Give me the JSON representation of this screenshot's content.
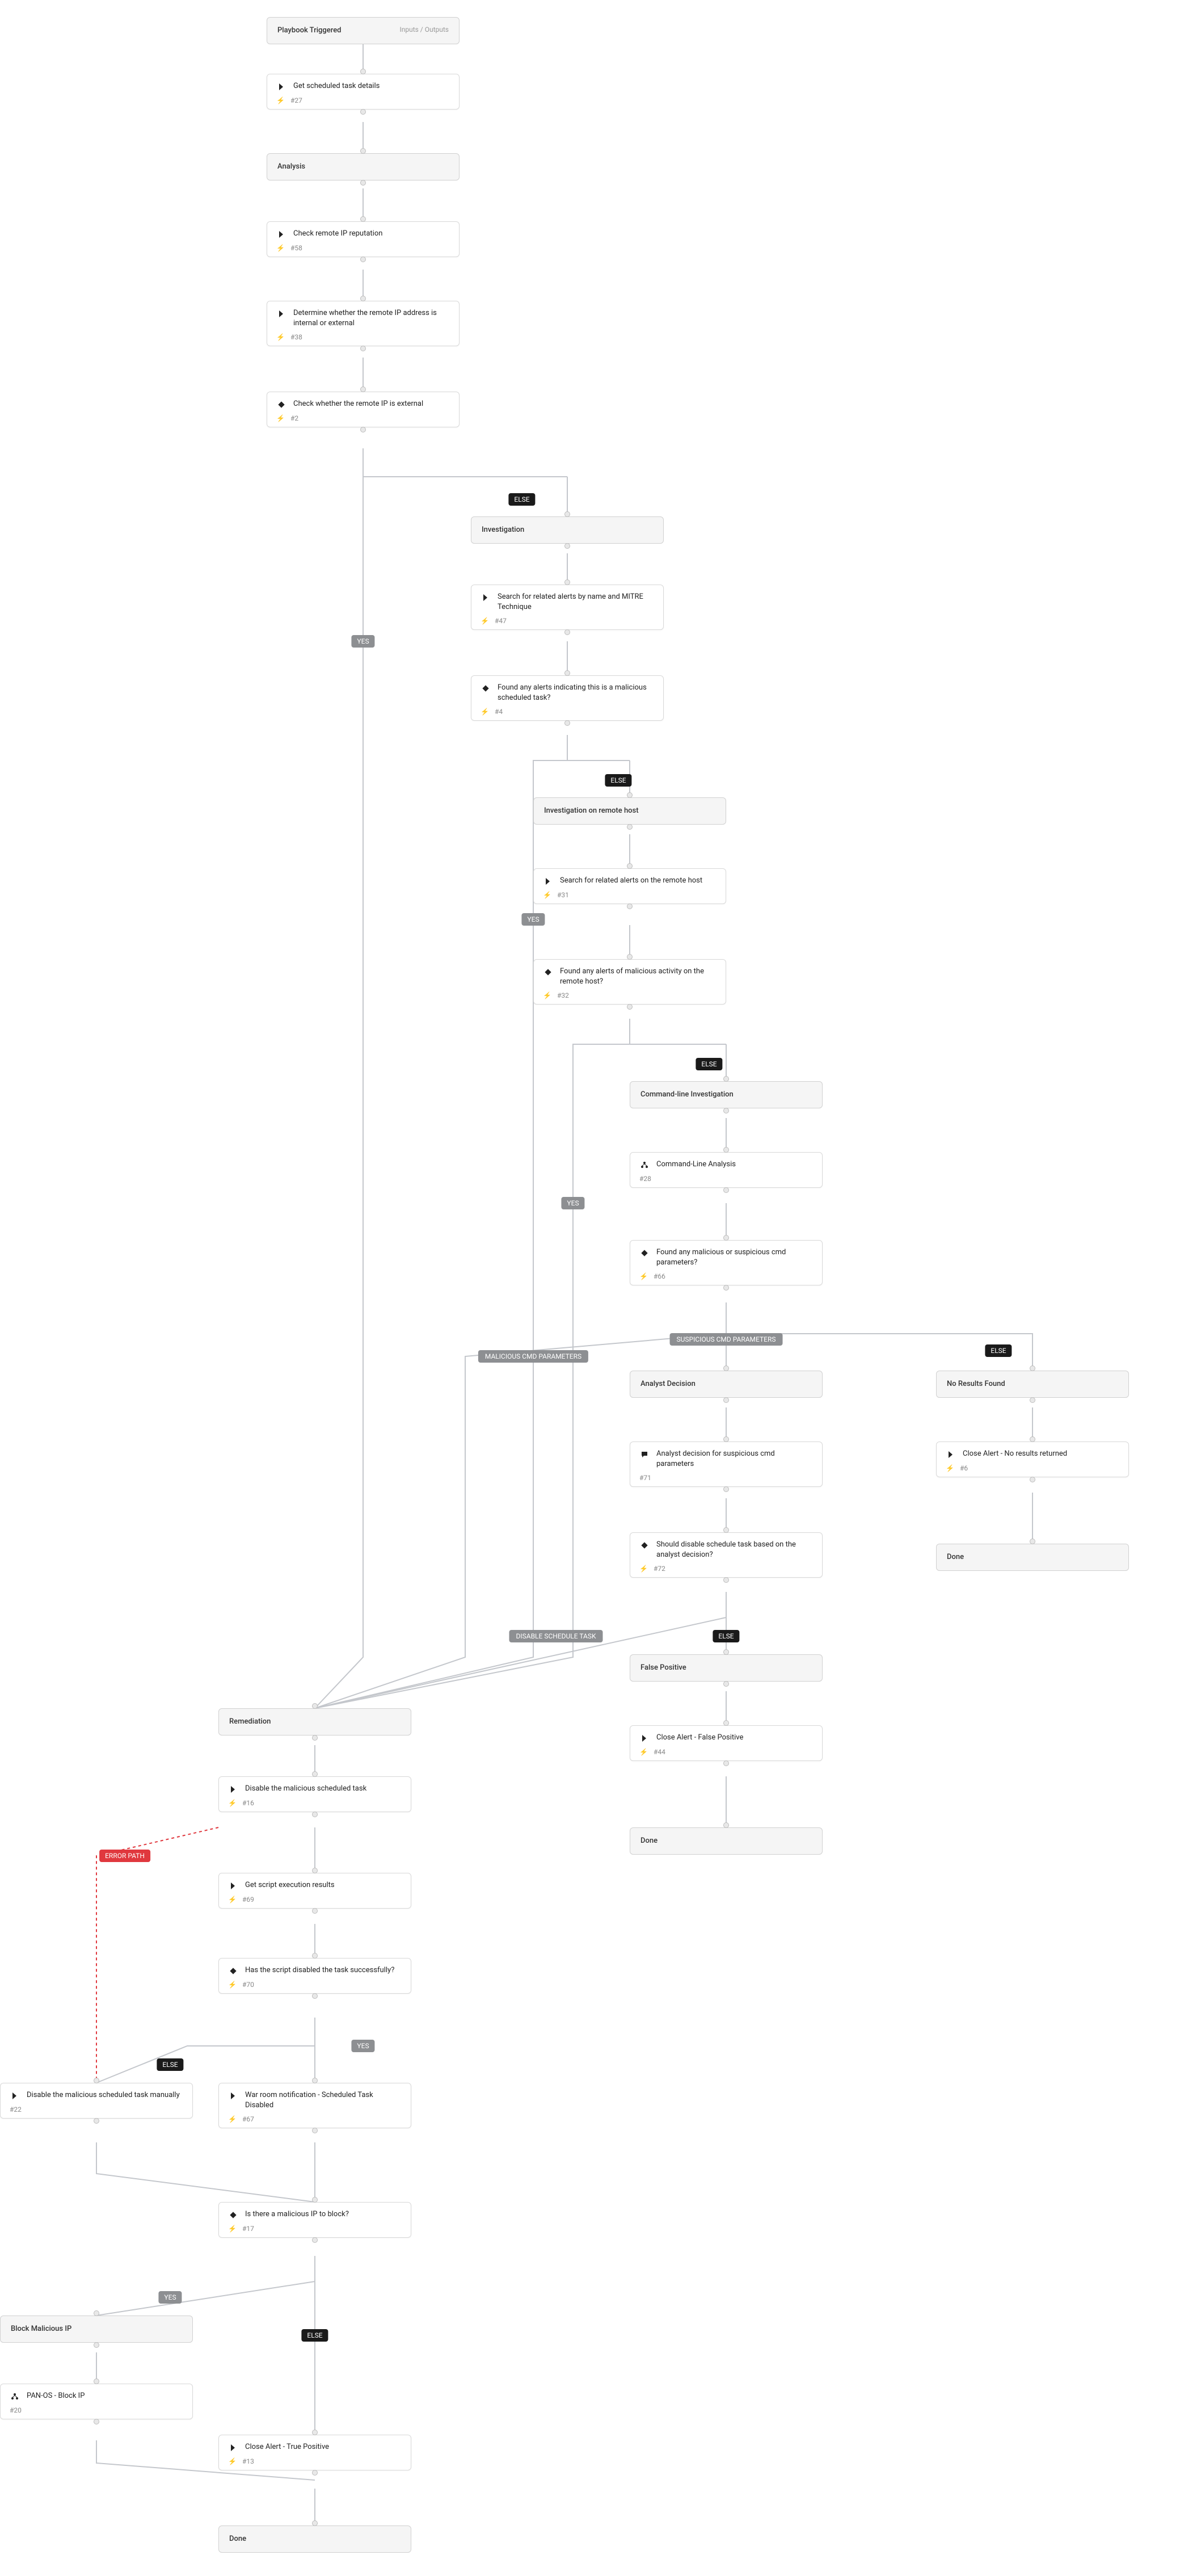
{
  "header": {
    "title": "Playbook Triggered",
    "io_label": "Inputs / Outputs"
  },
  "labels": {
    "yes": "YES",
    "else": "ELSE",
    "suspicious_cmd_parameters": "SUSPICIOUS CMD PARAMETERS",
    "malicious_cmd_parameters": "MALICIOUS CMD PARAMETERS",
    "disable_schedule_task": "DISABLE SCHEDULE TASK",
    "error_path": "ERROR PATH"
  },
  "sections": {
    "analysis": "Analysis",
    "investigation": "Investigation",
    "investigation_remote": "Investigation on remote host",
    "cmd_investigation": "Command-line Investigation",
    "analyst_decision": "Analyst Decision",
    "no_results": "No Results Found",
    "remediation": "Remediation",
    "false_positive": "False Positive",
    "block_ip": "Block Malicious IP",
    "done": "Done"
  },
  "tasks": {
    "t27": {
      "title": "Get scheduled task details",
      "id": "#27"
    },
    "t58": {
      "title": "Check remote IP reputation",
      "id": "#58"
    },
    "t38": {
      "title": "Determine whether the remote IP address is internal or external",
      "id": "#38"
    },
    "t2": {
      "title": "Check whether the remote IP is external",
      "id": "#2"
    },
    "t47": {
      "title": "Search for related alerts by name and MITRE Technique",
      "id": "#47"
    },
    "t4": {
      "title": "Found any alerts indicating this is a malicious scheduled task?",
      "id": "#4"
    },
    "t31": {
      "title": "Search for related alerts on the remote host",
      "id": "#31"
    },
    "t32": {
      "title": "Found any alerts of malicious activity on the remote host?",
      "id": "#32"
    },
    "t28": {
      "title": "Command-Line Analysis",
      "id": "#28"
    },
    "t66": {
      "title": "Found any malicious or suspicious cmd parameters?",
      "id": "#66"
    },
    "t71": {
      "title": "Analyst decision for suspicious cmd parameters",
      "id": "#71"
    },
    "t72": {
      "title": "Should disable schedule task based on the analyst decision?",
      "id": "#72"
    },
    "t6": {
      "title": "Close Alert - No results returned",
      "id": "#6"
    },
    "t16": {
      "title": "Disable the malicious scheduled task",
      "id": "#16"
    },
    "t69": {
      "title": "Get script execution results",
      "id": "#69"
    },
    "t70": {
      "title": "Has the script disabled the task successfully?",
      "id": "#70"
    },
    "t22": {
      "title": "Disable the malicious scheduled task manually",
      "id": "#22"
    },
    "t67": {
      "title": "War room notification - Scheduled Task Disabled",
      "id": "#67"
    },
    "t17": {
      "title": "Is there a malicious IP to block?",
      "id": "#17"
    },
    "t20": {
      "title": "PAN-OS - Block IP",
      "id": "#20"
    },
    "t13": {
      "title": "Close Alert - True Positive",
      "id": "#13"
    },
    "t44": {
      "title": "Close Alert - False Positive",
      "id": "#44"
    }
  },
  "chart_data": {
    "type": "flowchart",
    "nodes": [
      {
        "id": "start",
        "type": "start",
        "label": "Playbook Triggered"
      },
      {
        "id": "t27",
        "type": "task",
        "label": "Get scheduled task details",
        "task_id": "#27"
      },
      {
        "id": "sAnalysis",
        "type": "section",
        "label": "Analysis"
      },
      {
        "id": "t58",
        "type": "task",
        "label": "Check remote IP reputation",
        "task_id": "#58"
      },
      {
        "id": "t38",
        "type": "task",
        "label": "Determine whether the remote IP address is internal or external",
        "task_id": "#38"
      },
      {
        "id": "t2",
        "type": "condition",
        "label": "Check whether the remote IP is external",
        "task_id": "#2"
      },
      {
        "id": "sInvestigation",
        "type": "section",
        "label": "Investigation"
      },
      {
        "id": "t47",
        "type": "task",
        "label": "Search for related alerts by name and MITRE Technique",
        "task_id": "#47"
      },
      {
        "id": "t4",
        "type": "condition",
        "label": "Found any alerts indicating this is a malicious scheduled task?",
        "task_id": "#4"
      },
      {
        "id": "sInvRemote",
        "type": "section",
        "label": "Investigation on remote host"
      },
      {
        "id": "t31",
        "type": "task",
        "label": "Search for related alerts on the remote host",
        "task_id": "#31"
      },
      {
        "id": "t32",
        "type": "condition",
        "label": "Found any alerts of malicious activity on the remote host?",
        "task_id": "#32"
      },
      {
        "id": "sCmd",
        "type": "section",
        "label": "Command-line Investigation"
      },
      {
        "id": "t28",
        "type": "subplaybook",
        "label": "Command-Line Analysis",
        "task_id": "#28"
      },
      {
        "id": "t66",
        "type": "condition",
        "label": "Found any malicious or suspicious cmd parameters?",
        "task_id": "#66"
      },
      {
        "id": "sAnalyst",
        "type": "section",
        "label": "Analyst Decision"
      },
      {
        "id": "t71",
        "type": "datacollection",
        "label": "Analyst decision for suspicious cmd parameters",
        "task_id": "#71"
      },
      {
        "id": "t72",
        "type": "condition",
        "label": "Should disable schedule task based on the analyst decision?",
        "task_id": "#72"
      },
      {
        "id": "sNoRes",
        "type": "section",
        "label": "No Results Found"
      },
      {
        "id": "t6",
        "type": "task",
        "label": "Close Alert - No results returned",
        "task_id": "#6"
      },
      {
        "id": "doneN",
        "type": "end",
        "label": "Done"
      },
      {
        "id": "sRemed",
        "type": "section",
        "label": "Remediation"
      },
      {
        "id": "t16",
        "type": "task",
        "label": "Disable the malicious scheduled task",
        "task_id": "#16"
      },
      {
        "id": "t69",
        "type": "task",
        "label": "Get script execution results",
        "task_id": "#69"
      },
      {
        "id": "t70",
        "type": "condition",
        "label": "Has the script disabled the task successfully?",
        "task_id": "#70"
      },
      {
        "id": "t22",
        "type": "manual",
        "label": "Disable the malicious scheduled task manually",
        "task_id": "#22"
      },
      {
        "id": "t67",
        "type": "task",
        "label": "War room notification - Scheduled Task Disabled",
        "task_id": "#67"
      },
      {
        "id": "t17",
        "type": "condition",
        "label": "Is there a malicious IP to block?",
        "task_id": "#17"
      },
      {
        "id": "sBlock",
        "type": "section",
        "label": "Block Malicious IP"
      },
      {
        "id": "t20",
        "type": "subplaybook",
        "label": "PAN-OS - Block IP",
        "task_id": "#20"
      },
      {
        "id": "t13",
        "type": "task",
        "label": "Close Alert - True Positive",
        "task_id": "#13"
      },
      {
        "id": "doneR",
        "type": "end",
        "label": "Done"
      },
      {
        "id": "sFalse",
        "type": "section",
        "label": "False Positive"
      },
      {
        "id": "t44",
        "type": "task",
        "label": "Close Alert - False Positive",
        "task_id": "#44"
      },
      {
        "id": "doneF",
        "type": "end",
        "label": "Done"
      }
    ],
    "edges": [
      {
        "from": "start",
        "to": "t27"
      },
      {
        "from": "t27",
        "to": "sAnalysis"
      },
      {
        "from": "sAnalysis",
        "to": "t58"
      },
      {
        "from": "t58",
        "to": "t38"
      },
      {
        "from": "t38",
        "to": "t2"
      },
      {
        "from": "t2",
        "to": "sRemed",
        "label": "YES"
      },
      {
        "from": "t2",
        "to": "sInvestigation",
        "label": "ELSE"
      },
      {
        "from": "sInvestigation",
        "to": "t47"
      },
      {
        "from": "t47",
        "to": "t4"
      },
      {
        "from": "t4",
        "to": "sRemed",
        "label": "YES"
      },
      {
        "from": "t4",
        "to": "sInvRemote",
        "label": "ELSE"
      },
      {
        "from": "sInvRemote",
        "to": "t31"
      },
      {
        "from": "t31",
        "to": "t32"
      },
      {
        "from": "t32",
        "to": "sRemed",
        "label": "YES"
      },
      {
        "from": "t32",
        "to": "sCmd",
        "label": "ELSE"
      },
      {
        "from": "sCmd",
        "to": "t28"
      },
      {
        "from": "t28",
        "to": "t66"
      },
      {
        "from": "t66",
        "to": "sRemed",
        "label": "MALICIOUS CMD PARAMETERS"
      },
      {
        "from": "t66",
        "to": "sAnalyst",
        "label": "SUSPICIOUS CMD PARAMETERS"
      },
      {
        "from": "t66",
        "to": "sNoRes",
        "label": "ELSE"
      },
      {
        "from": "sAnalyst",
        "to": "t71"
      },
      {
        "from": "t71",
        "to": "t72"
      },
      {
        "from": "t72",
        "to": "sRemed",
        "label": "DISABLE SCHEDULE TASK"
      },
      {
        "from": "t72",
        "to": "sFalse",
        "label": "ELSE"
      },
      {
        "from": "sNoRes",
        "to": "t6"
      },
      {
        "from": "t6",
        "to": "doneN"
      },
      {
        "from": "sRemed",
        "to": "t16"
      },
      {
        "from": "t16",
        "to": "t69"
      },
      {
        "from": "t16",
        "to": "t22",
        "label": "ERROR PATH",
        "style": "error"
      },
      {
        "from": "t69",
        "to": "t70"
      },
      {
        "from": "t70",
        "to": "t67",
        "label": "YES"
      },
      {
        "from": "t70",
        "to": "t22",
        "label": "ELSE"
      },
      {
        "from": "t22",
        "to": "t17"
      },
      {
        "from": "t67",
        "to": "t17"
      },
      {
        "from": "t17",
        "to": "sBlock",
        "label": "YES"
      },
      {
        "from": "t17",
        "to": "t13",
        "label": "ELSE"
      },
      {
        "from": "sBlock",
        "to": "t20"
      },
      {
        "from": "t20",
        "to": "t13"
      },
      {
        "from": "t13",
        "to": "doneR"
      },
      {
        "from": "sFalse",
        "to": "t44"
      },
      {
        "from": "t44",
        "to": "doneF"
      }
    ]
  }
}
